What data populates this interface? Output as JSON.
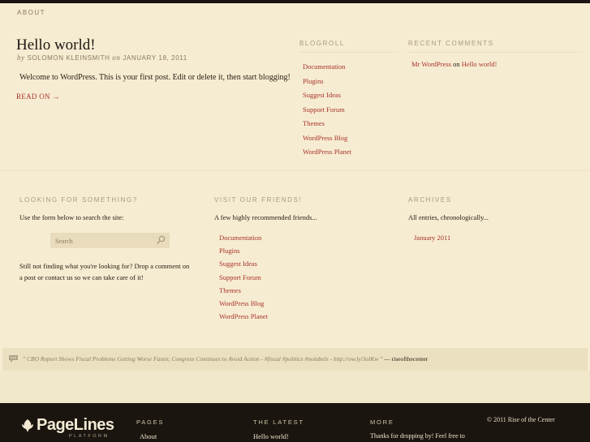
{
  "nav": {
    "about": "ABOUT"
  },
  "post": {
    "title": "Hello world!",
    "meta_by": "by",
    "author": "SOLOMON KLEINSMITH",
    "meta_on": "on",
    "date": "JANUARY 18, 2011",
    "body": "Welcome to WordPress. This is your first post. Edit or delete it, then start blogging!",
    "read_on": "READ ON →"
  },
  "blogroll": {
    "title": "BLOGROLL",
    "items": [
      "Documentation",
      "Plugins",
      "Suggest Ideas",
      "Support Forum",
      "Themes",
      "WordPress Blog",
      "WordPress Planet"
    ]
  },
  "recent_comments": {
    "title": "RECENT COMMENTS",
    "author": "Mr WordPress",
    "on": "on",
    "post": "Hello world!"
  },
  "search_widget": {
    "title": "LOOKING FOR SOMETHING?",
    "intro": "Use the form below to search the site:",
    "placeholder": "Search",
    "outro": "Still not finding what you're looking for? Drop a comment on a post or contact us so we can take care of it!"
  },
  "friends_widget": {
    "title": "VISIT OUR FRIENDS!",
    "intro": "A few highly recommended friends...",
    "items": [
      "Documentation",
      "Plugins",
      "Suggest Ideas",
      "Support Forum",
      "Themes",
      "WordPress Blog",
      "WordPress Planet"
    ]
  },
  "archives_widget": {
    "title": "ARCHIVES",
    "intro": "All entries, chronologically...",
    "items": [
      "January 2011"
    ]
  },
  "twitter": {
    "text": "\" CBO Report Shows Fiscal Problems Getting Worse Faster, Congress Continues to Avoid Action - #fiscal #politics #nolabels - http://ow.ly/3olKw \"",
    "dash": "—",
    "author": "riseofthecenter"
  },
  "footer": {
    "logo_text": "PageLines",
    "logo_sub": "PLATFORM",
    "pages_title": "PAGES",
    "pages_link": "About",
    "latest_title": "THE LATEST",
    "latest_link": "Hello world!",
    "more_title": "MORE",
    "more_text": "Thanks for dropping by! Feel free to",
    "copyright": "© 2011 Rise of the Center"
  },
  "colors": {
    "accent": "#a8322a",
    "background": "#f6ecd2",
    "footer": "#1a150f"
  },
  "icons": {
    "search": "search-icon",
    "twitter": "speech-bubble-icon",
    "logo": "leaf-icon"
  }
}
